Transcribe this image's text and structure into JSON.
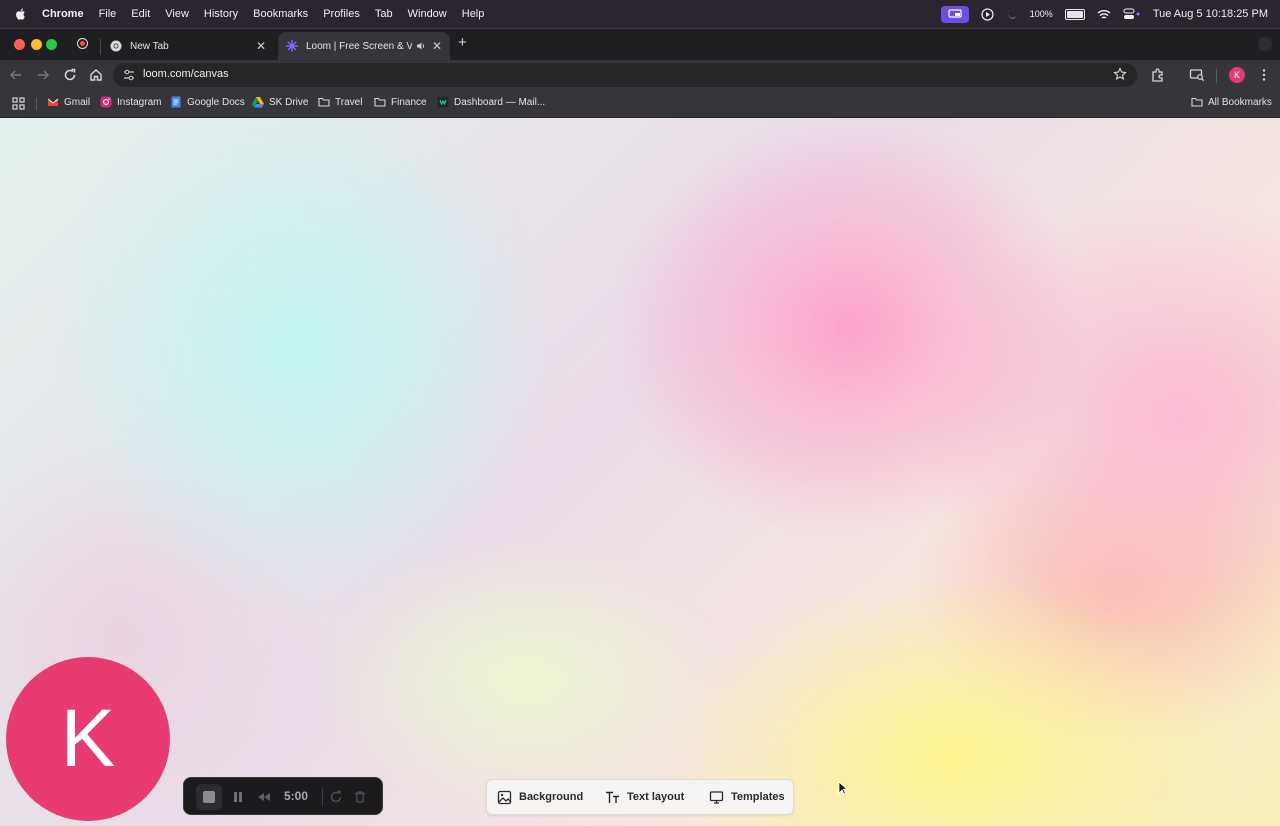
{
  "menubar": {
    "items": [
      "Chrome",
      "File",
      "Edit",
      "View",
      "History",
      "Bookmarks",
      "Profiles",
      "Tab",
      "Window",
      "Help"
    ],
    "battery": "100%",
    "clock": "Tue Aug 5  10:18:25 PM"
  },
  "tabs": [
    {
      "title": "New Tab",
      "favicon": "chrome-icon"
    },
    {
      "title": "Loom | Free Screen & Video Recording",
      "favicon": "loom-icon",
      "active": true
    }
  ],
  "toolbar": {
    "url": "loom.com/canvas",
    "profile_initial": "K"
  },
  "bookmarks": [
    {
      "label": "Gmail",
      "icon": "gmail-icon"
    },
    {
      "label": "Instagram",
      "icon": "instagram-icon"
    },
    {
      "label": "Google Docs",
      "icon": "docs-icon"
    },
    {
      "label": "SK Drive",
      "icon": "drive-icon"
    },
    {
      "label": "Travel",
      "icon": "folder-icon"
    },
    {
      "label": "Finance",
      "icon": "folder-icon"
    },
    {
      "label": "Dashboard — Mail...",
      "icon": "dashboard-icon"
    }
  ],
  "all_bookmarks": "All Bookmarks",
  "canvas": {
    "camera_initial": "K",
    "timer": "5:00",
    "tools": [
      "Background",
      "Text layout",
      "Templates"
    ]
  },
  "colors": {
    "accent": "#e73b72",
    "screen_share_badge": "#6a4fe0"
  }
}
